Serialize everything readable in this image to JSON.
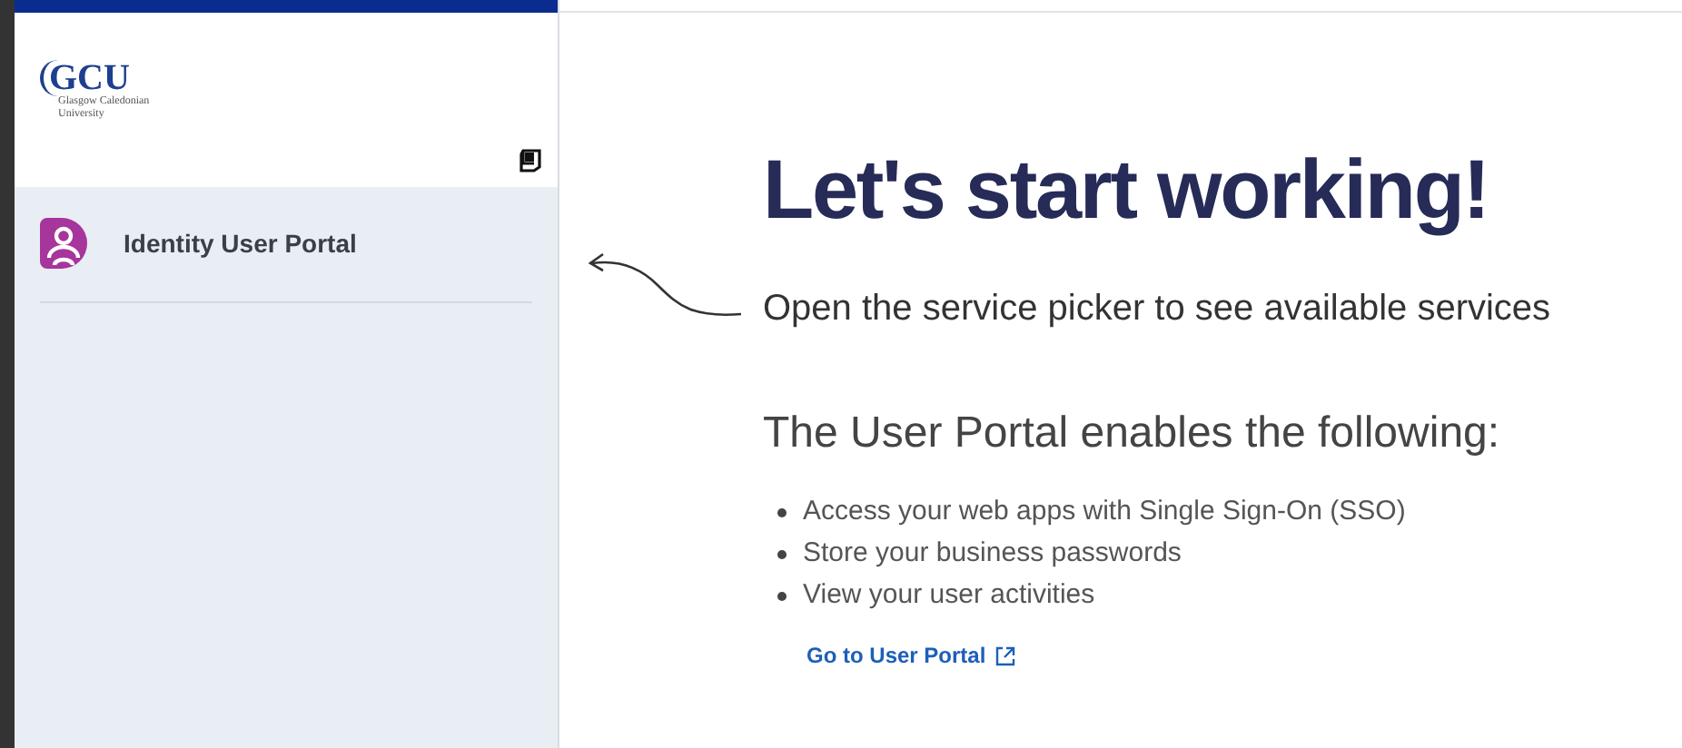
{
  "sidebar": {
    "logo": {
      "mark": "GCU",
      "name_lines": [
        "Glasgow Caledonian",
        "University"
      ]
    },
    "items": [
      {
        "label": "Identity User Portal"
      }
    ]
  },
  "main": {
    "title": "Let's start working!",
    "hint": "Open the service picker to see available services",
    "section_title": "The User Portal enables the following:",
    "features": [
      "Access your web apps with Single Sign-On (SSO)",
      "Store your business passwords",
      "View your user activities"
    ],
    "link": "Go to User Portal"
  }
}
